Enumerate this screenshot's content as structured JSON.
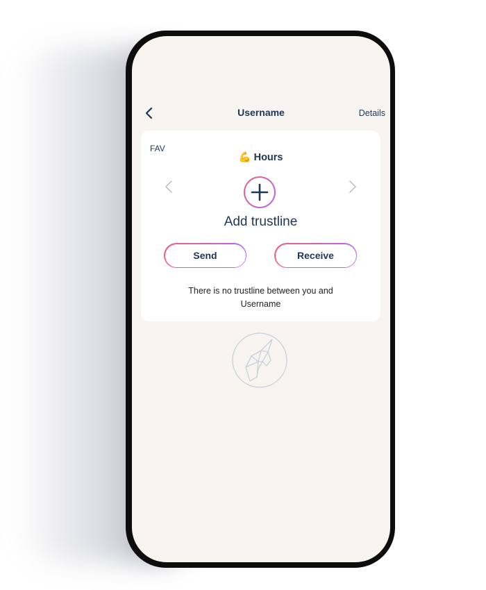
{
  "header": {
    "title": "Username",
    "details_label": "Details",
    "back_icon": "chevron-left-icon"
  },
  "card": {
    "fav_label": "FAV",
    "currency_emoji": "💪",
    "currency_label": "Hours",
    "add_icon": "plus-icon",
    "add_label": "Add trustline",
    "send_label": "Send",
    "receive_label": "Receive",
    "note_line1": "There is no trustline between you and",
    "note_line2": "Username"
  },
  "colors": {
    "text_primary": "#1d3557",
    "gradient_start": "#ef5f7c",
    "gradient_end": "#b066f0",
    "screen_bg": "#f8f5f0",
    "card_bg": "#ffffff"
  },
  "footer": {
    "logo_icon": "unicorn-logo-icon"
  }
}
